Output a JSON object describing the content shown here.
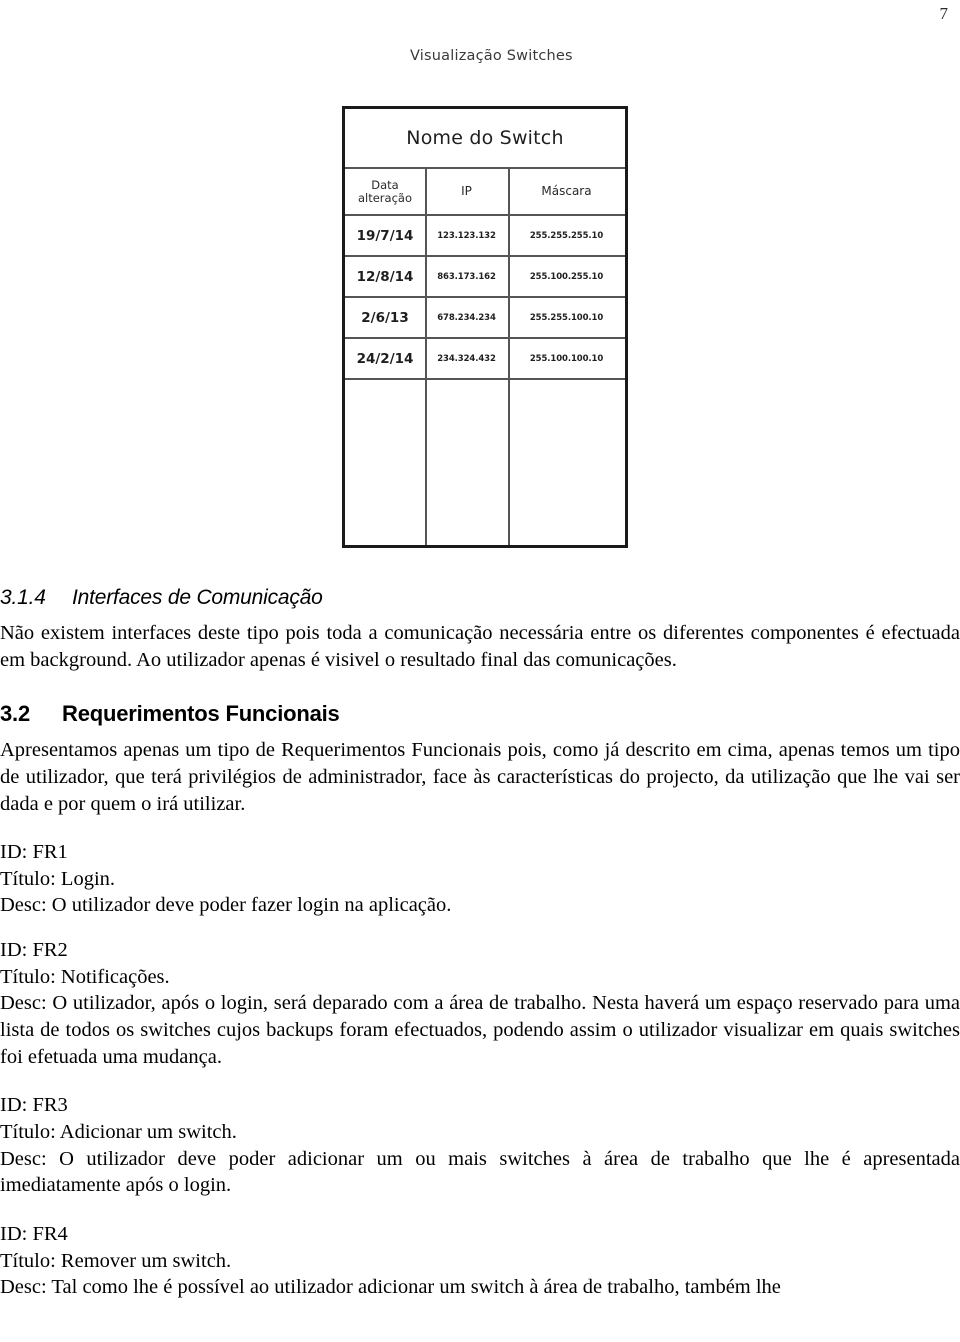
{
  "page": {
    "number": "7"
  },
  "figure": {
    "caption": "Visualização Switches",
    "table": {
      "title": "Nome do Switch",
      "columns": [
        "Data\nalteração",
        "IP",
        "Máscara"
      ],
      "column_labels": {
        "date_line1": "Data",
        "date_line2": "alteração",
        "ip": "IP",
        "mask": "Máscara"
      },
      "rows": [
        {
          "date": "19/7/14",
          "ip": "123.123.132",
          "mask": "255.255.255.10"
        },
        {
          "date": "12/8/14",
          "ip": "863.173.162",
          "mask": "255.100.255.10"
        },
        {
          "date": "2/6/13",
          "ip": "678.234.234",
          "mask": "255.255.100.10"
        },
        {
          "date": "24/2/14",
          "ip": "234.324.432",
          "mask": "255.100.100.10"
        }
      ]
    }
  },
  "sections": {
    "interfaces": {
      "number": "3.1.4",
      "title": "Interfaces de Comunicação",
      "body": "Não existem interfaces deste tipo pois toda a comunicação necessária entre os diferentes componentes é efectuada em background. Ao utilizador apenas é visivel o resultado final das comunicações."
    },
    "requirements": {
      "number": "3.2",
      "title": "Requerimentos Funcionais",
      "intro": "Apresentamos apenas um tipo de Requerimentos Funcionais pois, como já descrito em cima, apenas temos um tipo de utilizador, que terá privilégios de administrador, face às características do projecto, da utilização que lhe vai ser dada e por quem o irá utilizar.",
      "items": [
        {
          "id": "ID: FR1",
          "title": "Título: Login.",
          "desc": "Desc: O utilizador deve poder fazer login na aplicação."
        },
        {
          "id": "ID: FR2",
          "title": "Título: Notificações.",
          "desc": "Desc: O utilizador, após o login, será deparado com a área de trabalho. Nesta haverá um espaço reservado para uma lista de todos os switches cujos backups foram efectuados, podendo assim o utilizador visualizar em quais switches foi efetuada uma mudança."
        },
        {
          "id": "ID: FR3",
          "title": "Título: Adicionar um switch.",
          "desc": "Desc: O utilizador deve poder adicionar um ou mais switches à área de trabalho que lhe é apresentada imediatamente após o login."
        },
        {
          "id": "ID: FR4",
          "title": "Título: Remover um switch.",
          "desc": "Desc: Tal como lhe é possível ao utilizador adicionar um switch à área de trabalho, também lhe"
        }
      ]
    }
  }
}
